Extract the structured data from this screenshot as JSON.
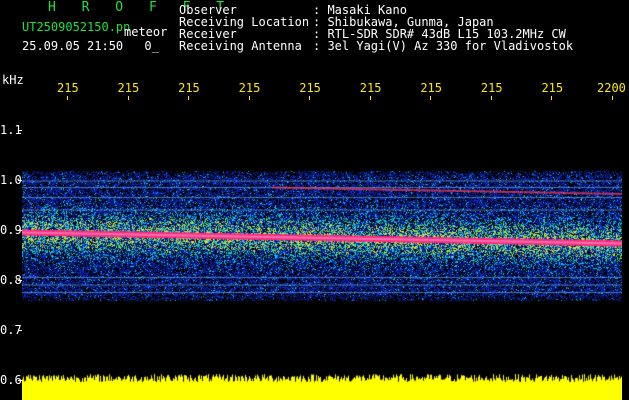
{
  "header": {
    "title": "H R O F F T",
    "filename": "UT2509052150.pn",
    "meteor_label": "meteor",
    "datetime": "25.09.05 21:50",
    "counter": "0_",
    "info": [
      {
        "key": "Observer",
        "value": ": Masaki Kano"
      },
      {
        "key": "Receiving Location",
        "value": ": Shibukawa, Gunma, Japan"
      },
      {
        "key": "Receiver",
        "value": ": RTL-SDR SDR# 43dB L15 103.2MHz CW"
      },
      {
        "key": "Receiving Antenna",
        "value": ": 3el Yagi(V) Az 330 for Vladivostok"
      }
    ]
  },
  "axis": {
    "y_unit": "kHz",
    "y_ticks": [
      {
        "label": "1.1",
        "value": 1.1
      },
      {
        "label": "1.0",
        "value": 1.0
      },
      {
        "label": "0.9",
        "value": 0.9
      },
      {
        "label": "0.8",
        "value": 0.8
      },
      {
        "label": "0.7",
        "value": 0.7
      },
      {
        "label": "0.6",
        "value": 0.6
      }
    ],
    "x_ticks": [
      "215",
      "215",
      "215",
      "215",
      "215",
      "215",
      "215",
      "215",
      "215",
      "2200"
    ]
  },
  "colors": {
    "title_green": "#22e040",
    "tick_yellow": "#ffe800",
    "signal_pink": "#ff2a80",
    "noise_blue": "#1c2cc8",
    "baseline_yellow": "#ffff00"
  }
}
